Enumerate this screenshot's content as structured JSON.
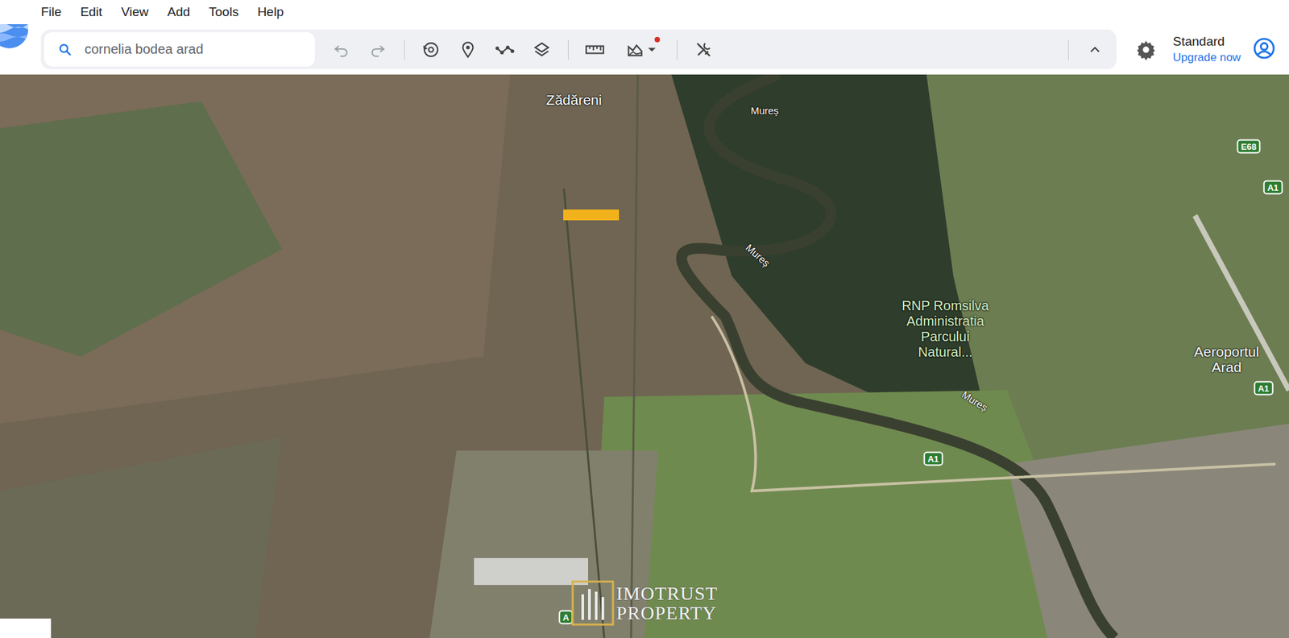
{
  "menu": [
    {
      "label": "File"
    },
    {
      "label": "Edit"
    },
    {
      "label": "View"
    },
    {
      "label": "Add"
    },
    {
      "label": "Tools"
    },
    {
      "label": "Help"
    }
  ],
  "search": {
    "value": "cornelia bodea arad"
  },
  "toolbar": {
    "map_style_notice": true
  },
  "account": {
    "plan": "Standard",
    "upgrade": "Upgrade now"
  },
  "map": {
    "labels": [
      {
        "text": "Zădăreni",
        "kind": "place"
      },
      {
        "text": "Mureș",
        "kind": "river"
      },
      {
        "text": "Mureș",
        "kind": "river"
      },
      {
        "text": "RNP Romsilva Administratia Parcului Natural...",
        "kind": "poi"
      },
      {
        "text": "Aeroportul Arad",
        "kind": "place"
      },
      {
        "text": "Mureș",
        "kind": "river"
      },
      {
        "text": "E68",
        "kind": "road"
      },
      {
        "text": "A1",
        "kind": "road"
      },
      {
        "text": "A1",
        "kind": "road"
      },
      {
        "text": "A1",
        "kind": "road"
      },
      {
        "text": "A",
        "kind": "road"
      }
    ],
    "watermark": {
      "lines": [
        "IMOTRUST",
        "PROPERTY"
      ]
    }
  }
}
